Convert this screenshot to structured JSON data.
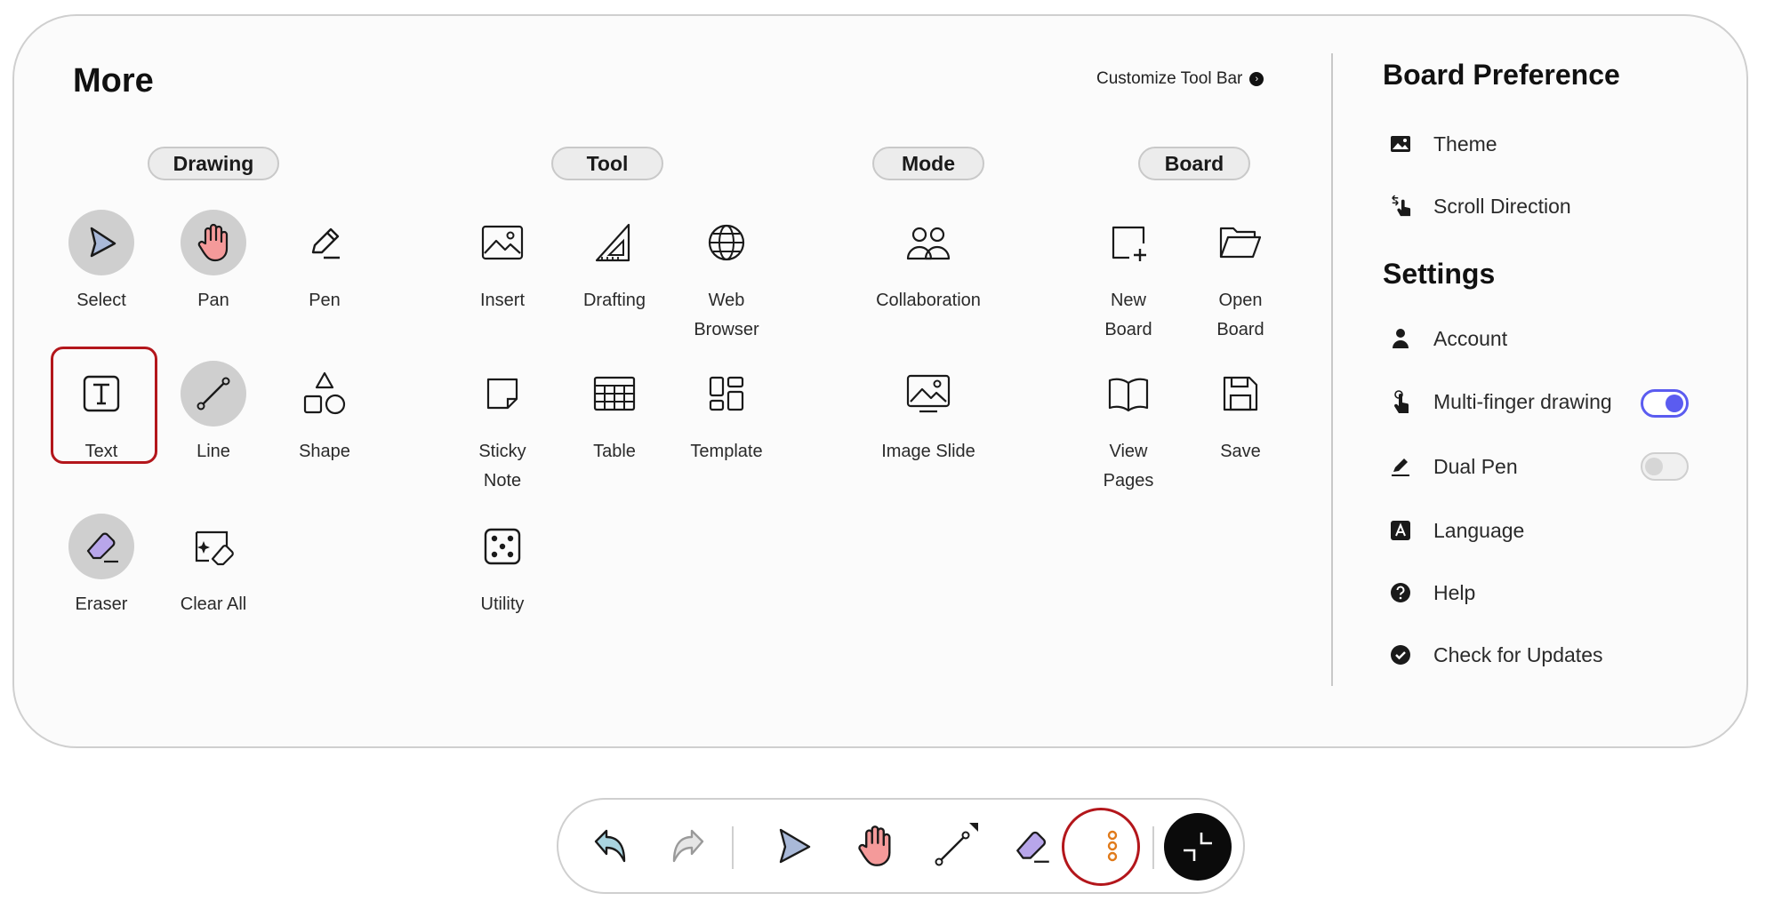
{
  "header": {
    "title": "More",
    "customize_label": "Customize Tool Bar"
  },
  "categories": {
    "drawing": "Drawing",
    "tool": "Tool",
    "mode": "Mode",
    "board": "Board"
  },
  "tools": {
    "select": "Select",
    "pan": "Pan",
    "pen": "Pen",
    "text": "Text",
    "line": "Line",
    "shape": "Shape",
    "eraser": "Eraser",
    "clear_all": "Clear All",
    "insert": "Insert",
    "drafting": "Drafting",
    "web_browser": "Web\nBrowser",
    "sticky_note": "Sticky\nNote",
    "table": "Table",
    "template": "Template",
    "utility": "Utility",
    "collaboration": "Collaboration",
    "image_slide": "Image Slide",
    "new_board": "New\nBoard",
    "open_board": "Open\nBoard",
    "view_pages": "View\nPages",
    "save": "Save"
  },
  "board_preference": {
    "title": "Board Preference",
    "items": [
      "Theme",
      "Scroll Direction"
    ]
  },
  "settings": {
    "title": "Settings",
    "account": "Account",
    "multi_finger": "Multi-finger drawing",
    "multi_finger_on": true,
    "dual_pen": "Dual Pen",
    "dual_pen_on": false,
    "language": "Language",
    "help": "Help",
    "updates": "Check for Updates"
  },
  "colors": {
    "accent": "#5b5cf0",
    "highlight": "#b3161b",
    "select_fill": "#a9b9d8",
    "hand_fill": "#f49a9a",
    "eraser_fill": "#b8a6ea"
  }
}
